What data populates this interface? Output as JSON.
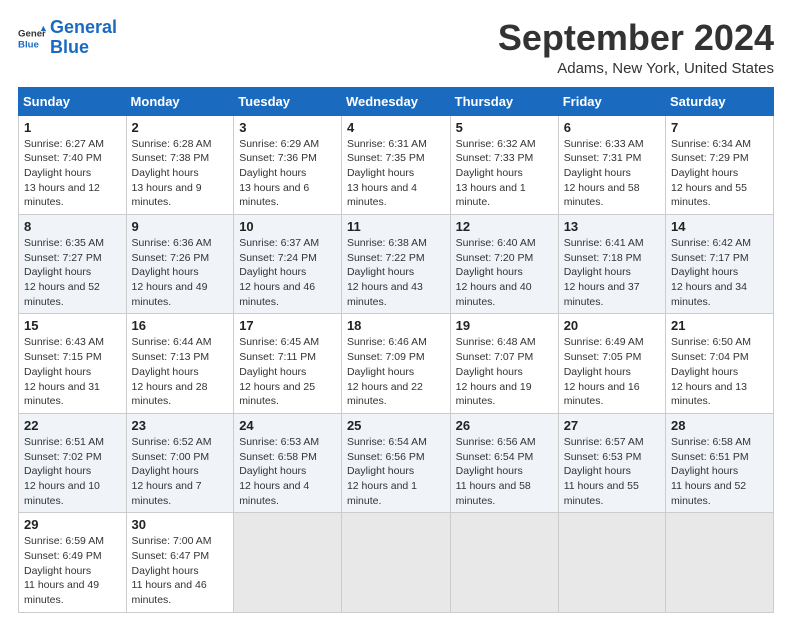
{
  "logo": {
    "text_general": "General",
    "text_blue": "Blue"
  },
  "header": {
    "month": "September 2024",
    "location": "Adams, New York, United States"
  },
  "days_of_week": [
    "Sunday",
    "Monday",
    "Tuesday",
    "Wednesday",
    "Thursday",
    "Friday",
    "Saturday"
  ],
  "weeks": [
    [
      {
        "day": "1",
        "sunrise": "6:27 AM",
        "sunset": "7:40 PM",
        "daylight": "13 hours and 12 minutes."
      },
      {
        "day": "2",
        "sunrise": "6:28 AM",
        "sunset": "7:38 PM",
        "daylight": "13 hours and 9 minutes."
      },
      {
        "day": "3",
        "sunrise": "6:29 AM",
        "sunset": "7:36 PM",
        "daylight": "13 hours and 6 minutes."
      },
      {
        "day": "4",
        "sunrise": "6:31 AM",
        "sunset": "7:35 PM",
        "daylight": "13 hours and 4 minutes."
      },
      {
        "day": "5",
        "sunrise": "6:32 AM",
        "sunset": "7:33 PM",
        "daylight": "13 hours and 1 minute."
      },
      {
        "day": "6",
        "sunrise": "6:33 AM",
        "sunset": "7:31 PM",
        "daylight": "12 hours and 58 minutes."
      },
      {
        "day": "7",
        "sunrise": "6:34 AM",
        "sunset": "7:29 PM",
        "daylight": "12 hours and 55 minutes."
      }
    ],
    [
      {
        "day": "8",
        "sunrise": "6:35 AM",
        "sunset": "7:27 PM",
        "daylight": "12 hours and 52 minutes."
      },
      {
        "day": "9",
        "sunrise": "6:36 AM",
        "sunset": "7:26 PM",
        "daylight": "12 hours and 49 minutes."
      },
      {
        "day": "10",
        "sunrise": "6:37 AM",
        "sunset": "7:24 PM",
        "daylight": "12 hours and 46 minutes."
      },
      {
        "day": "11",
        "sunrise": "6:38 AM",
        "sunset": "7:22 PM",
        "daylight": "12 hours and 43 minutes."
      },
      {
        "day": "12",
        "sunrise": "6:40 AM",
        "sunset": "7:20 PM",
        "daylight": "12 hours and 40 minutes."
      },
      {
        "day": "13",
        "sunrise": "6:41 AM",
        "sunset": "7:18 PM",
        "daylight": "12 hours and 37 minutes."
      },
      {
        "day": "14",
        "sunrise": "6:42 AM",
        "sunset": "7:17 PM",
        "daylight": "12 hours and 34 minutes."
      }
    ],
    [
      {
        "day": "15",
        "sunrise": "6:43 AM",
        "sunset": "7:15 PM",
        "daylight": "12 hours and 31 minutes."
      },
      {
        "day": "16",
        "sunrise": "6:44 AM",
        "sunset": "7:13 PM",
        "daylight": "12 hours and 28 minutes."
      },
      {
        "day": "17",
        "sunrise": "6:45 AM",
        "sunset": "7:11 PM",
        "daylight": "12 hours and 25 minutes."
      },
      {
        "day": "18",
        "sunrise": "6:46 AM",
        "sunset": "7:09 PM",
        "daylight": "12 hours and 22 minutes."
      },
      {
        "day": "19",
        "sunrise": "6:48 AM",
        "sunset": "7:07 PM",
        "daylight": "12 hours and 19 minutes."
      },
      {
        "day": "20",
        "sunrise": "6:49 AM",
        "sunset": "7:05 PM",
        "daylight": "12 hours and 16 minutes."
      },
      {
        "day": "21",
        "sunrise": "6:50 AM",
        "sunset": "7:04 PM",
        "daylight": "12 hours and 13 minutes."
      }
    ],
    [
      {
        "day": "22",
        "sunrise": "6:51 AM",
        "sunset": "7:02 PM",
        "daylight": "12 hours and 10 minutes."
      },
      {
        "day": "23",
        "sunrise": "6:52 AM",
        "sunset": "7:00 PM",
        "daylight": "12 hours and 7 minutes."
      },
      {
        "day": "24",
        "sunrise": "6:53 AM",
        "sunset": "6:58 PM",
        "daylight": "12 hours and 4 minutes."
      },
      {
        "day": "25",
        "sunrise": "6:54 AM",
        "sunset": "6:56 PM",
        "daylight": "12 hours and 1 minute."
      },
      {
        "day": "26",
        "sunrise": "6:56 AM",
        "sunset": "6:54 PM",
        "daylight": "11 hours and 58 minutes."
      },
      {
        "day": "27",
        "sunrise": "6:57 AM",
        "sunset": "6:53 PM",
        "daylight": "11 hours and 55 minutes."
      },
      {
        "day": "28",
        "sunrise": "6:58 AM",
        "sunset": "6:51 PM",
        "daylight": "11 hours and 52 minutes."
      }
    ],
    [
      {
        "day": "29",
        "sunrise": "6:59 AM",
        "sunset": "6:49 PM",
        "daylight": "11 hours and 49 minutes."
      },
      {
        "day": "30",
        "sunrise": "7:00 AM",
        "sunset": "6:47 PM",
        "daylight": "11 hours and 46 minutes."
      },
      null,
      null,
      null,
      null,
      null
    ]
  ]
}
